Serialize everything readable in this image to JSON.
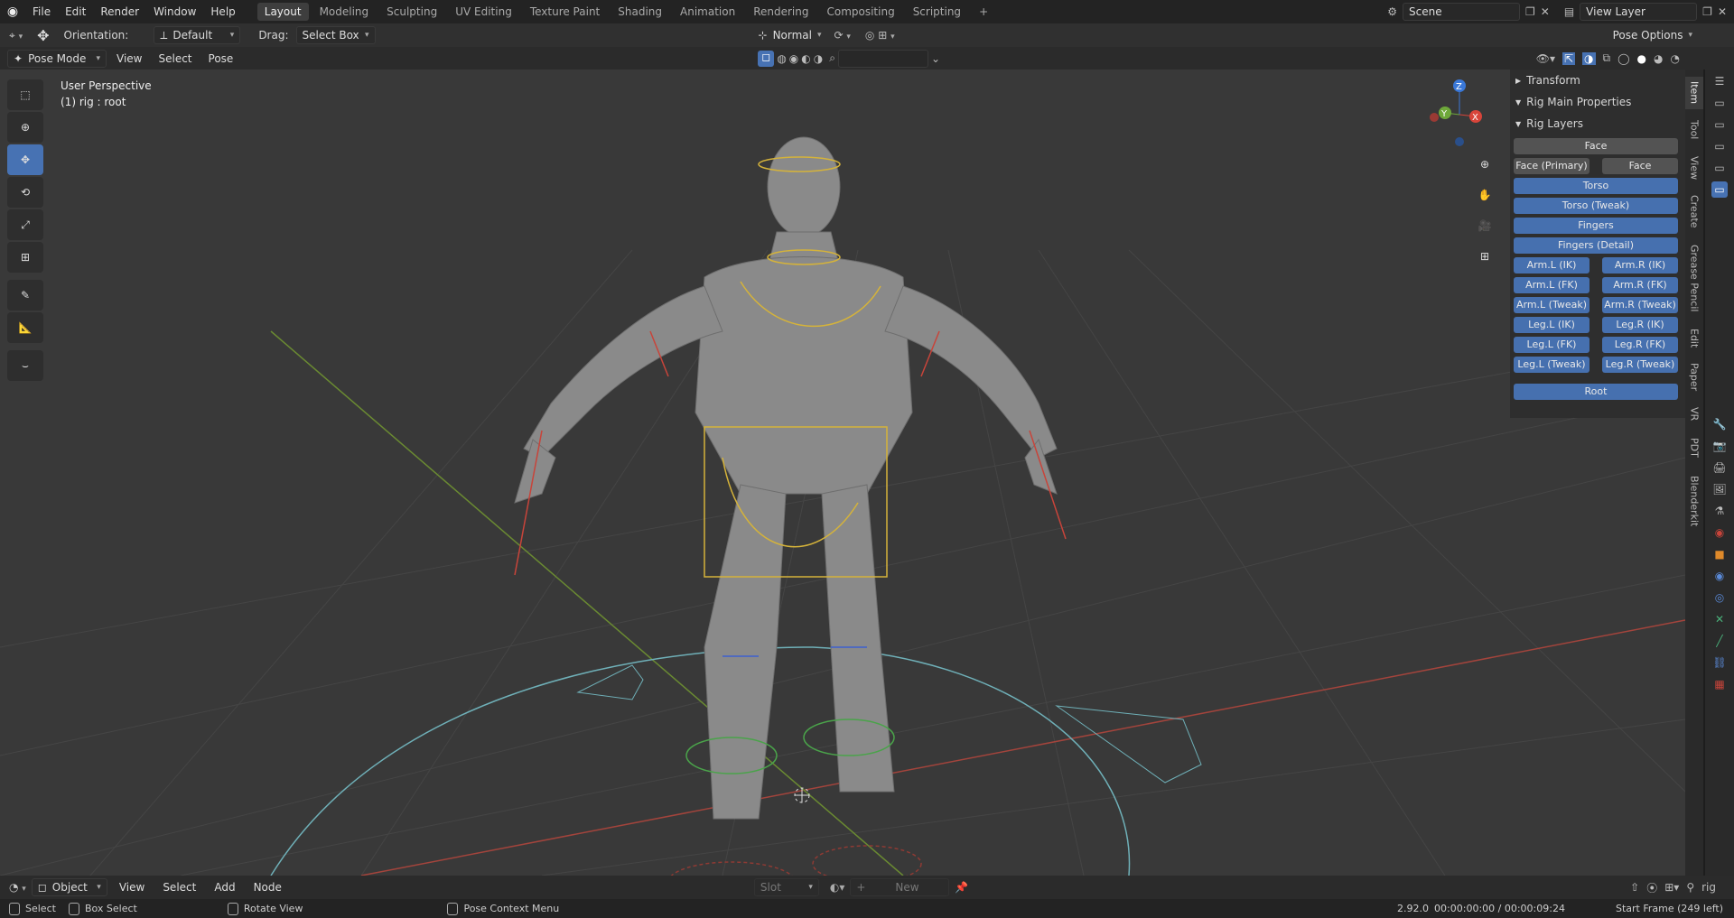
{
  "topbar": {
    "menus": [
      "File",
      "Edit",
      "Render",
      "Window",
      "Help"
    ],
    "workspaces": [
      "Layout",
      "Modeling",
      "Sculpting",
      "UV Editing",
      "Texture Paint",
      "Shading",
      "Animation",
      "Rendering",
      "Compositing",
      "Scripting"
    ],
    "active_workspace": "Layout",
    "add_icon": "plus-icon",
    "scene": "Scene",
    "view_layer": "View Layer"
  },
  "header2": {
    "orientation_label": "Orientation:",
    "orientation_value": "Default",
    "drag_label": "Drag:",
    "drag_value": "Select Box",
    "pivot_value": "Normal",
    "pose_options": "Pose Options"
  },
  "header3": {
    "mode": "Pose Mode",
    "menus": [
      "View",
      "Select",
      "Pose"
    ]
  },
  "viewport": {
    "perspective": "User Perspective",
    "active": "(1) rig : root",
    "gizmo": {
      "x": "X",
      "y": "Y",
      "z": "Z"
    },
    "colors": {
      "bg": "#393939",
      "x_axis": "#d8453a",
      "y_axis": "#6ea83a",
      "z_axis": "#3a78d8",
      "grid": "#454545",
      "arm_yellow": "#d5b33a",
      "arm_cyan": "#6fb0b8",
      "arm_red": "#c8443a",
      "arm_green": "#4aa34a",
      "arm_blue": "#3c5fd0"
    }
  },
  "npanel": {
    "sections": {
      "transform": "Transform",
      "rig_main": "Rig Main Properties",
      "rig_layers": "Rig Layers"
    },
    "face": "Face",
    "face_primary": "Face (Primary)",
    "face_secondary": "Face (Seconda...",
    "torso": "Torso",
    "torso_tweak": "Torso (Tweak)",
    "fingers": "Fingers",
    "fingers_detail": "Fingers (Detail)",
    "pairs": [
      [
        "Arm.L (IK)",
        "Arm.R (IK)"
      ],
      [
        "Arm.L (FK)",
        "Arm.R (FK)"
      ],
      [
        "Arm.L (Tweak)",
        "Arm.R (Tweak)"
      ],
      [
        "Leg.L (IK)",
        "Leg.R (IK)"
      ],
      [
        "Leg.L (FK)",
        "Leg.R (FK)"
      ],
      [
        "Leg.L (Tweak)",
        "Leg.R (Tweak)"
      ]
    ],
    "root": "Root"
  },
  "tabs": [
    "Item",
    "Tool",
    "View",
    "Create",
    "Grease Pencil",
    "Edit",
    "Paper",
    "VR",
    "PDT",
    "Blenderkit"
  ],
  "timebar": {
    "object": "Object",
    "menus": [
      "View",
      "Select",
      "Add",
      "Node"
    ],
    "slot": "Slot",
    "new": "New",
    "rig": "rig"
  },
  "statusbar": {
    "select": "Select",
    "box_select": "Box Select",
    "rotate": "Rotate View",
    "context": "Pose Context Menu",
    "version": "2.92.0",
    "time": "00:00:00:00 / 00:00:09:24",
    "frame": "Start Frame (249 left)"
  }
}
